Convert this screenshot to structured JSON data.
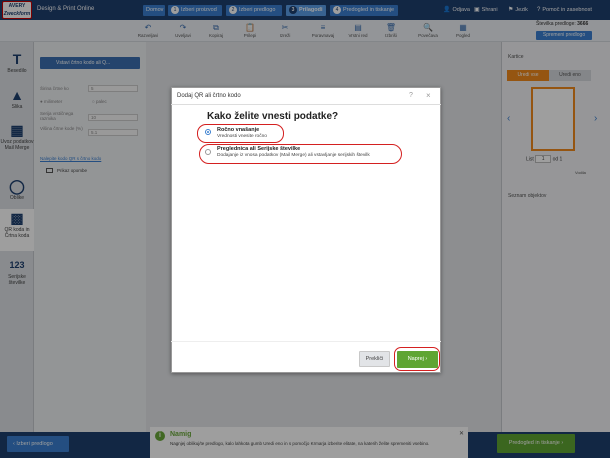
{
  "header": {
    "logo_line1": "AVERY",
    "logo_line2": "Zweckform",
    "product": "Design & Print Online",
    "steps": [
      {
        "label": "Domov"
      },
      {
        "num": "1",
        "label": "Izberi proizvod"
      },
      {
        "num": "2",
        "label": "Izberi predlogo"
      },
      {
        "num": "3",
        "label": "Prilagodi"
      },
      {
        "num": "4",
        "label": "Predogled in tiskanje"
      }
    ],
    "links": {
      "logout": "Odjava",
      "save": "Shrani",
      "language": "Jezik",
      "help": "Pomoč in zasebnost"
    }
  },
  "toolbar": {
    "items": [
      "Razveljavi",
      "Uveljavi",
      "Kopiraj",
      "Prilepi",
      "Izreži",
      "Poravnavaj",
      "Vrstni red",
      "Izbriši",
      "Povečava",
      "Pogled"
    ],
    "code_label": "Številka predloge:",
    "code_value": "3666",
    "modify_button": "Spremeni predlogo"
  },
  "leftbar": {
    "items": [
      {
        "icon": "T",
        "label": "Besedilo"
      },
      {
        "icon": "▲",
        "label": "Slika"
      },
      {
        "icon": "▦",
        "label": "Uvoz podatkov Mail Merge"
      },
      {
        "icon": "◯",
        "label": "Oblike"
      },
      {
        "icon": "▩",
        "label": "QR koda in Črtna koda"
      },
      {
        "icon": "123",
        "label": "Serijske številke"
      }
    ]
  },
  "leftpanel": {
    "button": "Vstavi črtno kodo ali Q...",
    "fields": [
      {
        "label": "Širina črtne ko",
        "value": "5"
      },
      {
        "label": "Serija vrstičnega razmika",
        "value": "10"
      },
      {
        "label": "Višina črtne kode (%)",
        "value": "5.1"
      }
    ],
    "radio1": "milimeter",
    "radio2": "palec",
    "link": "Nalepite kodo QR s črtno kodo",
    "checkbox": "Prikaz opombe"
  },
  "right": {
    "title": "Kartice",
    "tab_edit_all": "Uredi vse",
    "tab_edit_one": "Uredi eno",
    "sheet_label": "List",
    "sheet_value": "1",
    "of_label": "od 1",
    "objects_title": "Seznam objektov",
    "grid_toggle": "Vodila"
  },
  "dialog": {
    "title": "Dodaj QR ali črtno kodo",
    "help": "?",
    "close": "×",
    "question": "Kako želite vnesti podatke?",
    "option1_label": "Ročno vnašanje",
    "option1_desc": "Vrednosti vnesite ročno",
    "option2_label": "Preglednica ali Serijske številke",
    "option2_desc": "Dodajanje iz vnosa podatkov (Mail Merge) ali vstavljanje serijskih številk",
    "prev_button": "Prekliči",
    "next_button": "Naprej"
  },
  "footer": {
    "back_button": "Izberi predlogo",
    "tip_title": "Namig",
    "tip_text": "Nagnjej oblikuj/te predlogo, kalo lahkota gumb Uredi eno in s pomočjo Krmarja izberite elitate, na katerih želite spremeniti vsebino.",
    "next_button": "Predogled in tiskanje"
  },
  "colors": {
    "brand": "#1e3f6f",
    "accent": "#3a7fd0",
    "orange": "#f08a1c",
    "green": "#5fa533",
    "highlight": "#d42020"
  }
}
